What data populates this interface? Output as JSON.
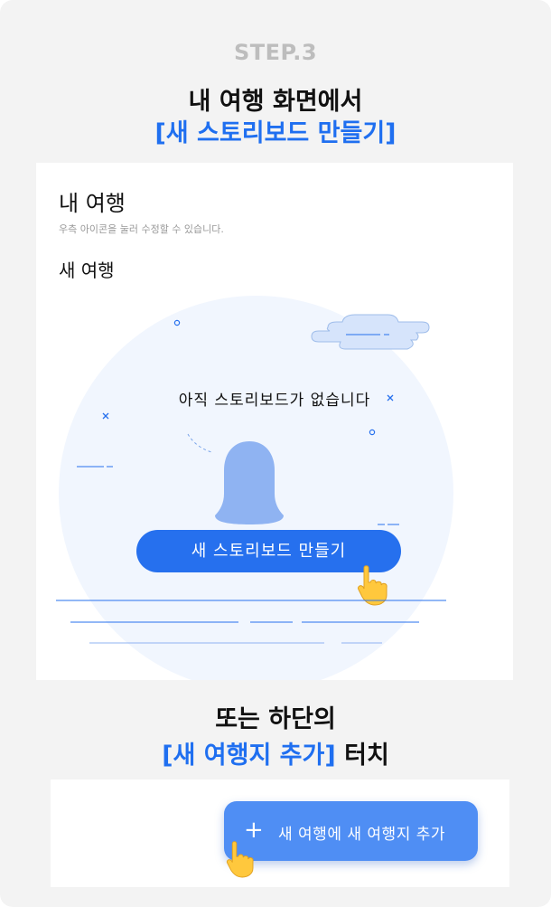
{
  "step_label": "STEP.3",
  "heading_line1": "내 여행 화면에서",
  "heading_line2": "[새 스토리보드 만들기]",
  "screen1": {
    "title": "내 여행",
    "subtitle": "우측 아이콘을 눌러 수정할 수 있습니다.",
    "section_title": "새 여행",
    "empty_message": "아직 스토리보드가 없습니다",
    "create_button_label": "새 스토리보드 만들기"
  },
  "or_line1": "또는 하단의",
  "or_line2_highlight": "[새 여행지 추가]",
  "or_line2_rest": " 터치",
  "screen2": {
    "add_button_label": "새 여행에 새 여행지 추가",
    "add_icon": "plus-icon"
  },
  "colors": {
    "accent": "#1f6ff0",
    "button_blue": "#2670ee",
    "light_button_blue": "#4f8ef4",
    "step_gray": "#bdbdbd",
    "background": "#f3f3f3",
    "illustration_bg": "#f1f6fe",
    "ghost": "#8fb3f2",
    "hand": "#ffc83d"
  }
}
